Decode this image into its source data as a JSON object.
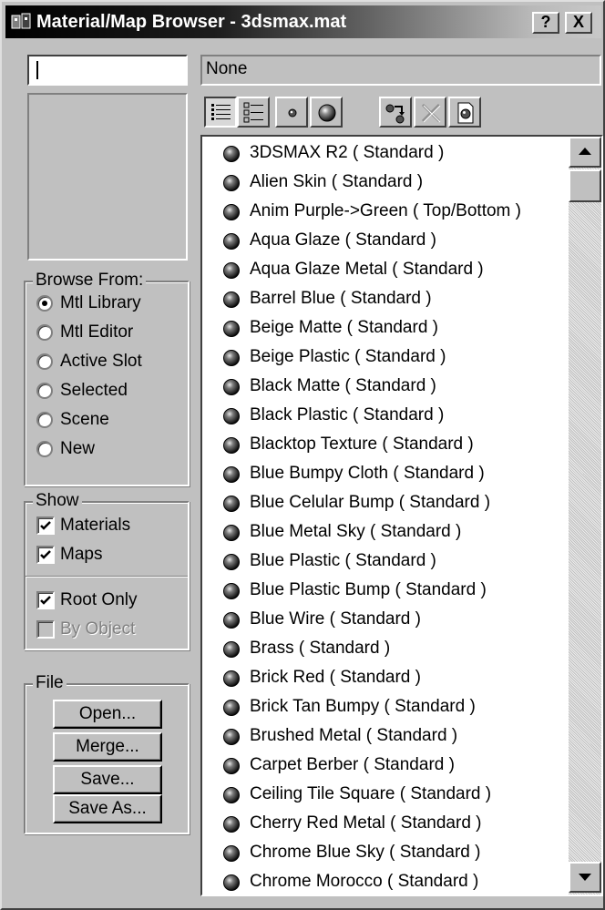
{
  "window": {
    "title": "Material/Map Browser - 3dsmax.mat",
    "help_label": "?",
    "close_label": "X"
  },
  "search": {
    "value": ""
  },
  "name_field": {
    "value": "None"
  },
  "toolbar": {
    "buttons": [
      "view-list",
      "view-list-icons",
      "view-small-icons",
      "view-large-icons",
      "update-scene-materials",
      "delete-from-library",
      "clear-material-library"
    ]
  },
  "browse_from": {
    "title": "Browse From:",
    "options": [
      "Mtl Library",
      "Mtl Editor",
      "Active Slot",
      "Selected",
      "Scene",
      "New"
    ],
    "selected": "Mtl Library"
  },
  "show": {
    "title": "Show",
    "materials_label": "Materials",
    "materials_checked": true,
    "maps_label": "Maps",
    "maps_checked": true,
    "root_only_label": "Root Only",
    "root_only_checked": true,
    "by_object_label": "By Object",
    "by_object_checked": false
  },
  "file": {
    "title": "File",
    "open_label": "Open...",
    "merge_label": "Merge...",
    "save_label": "Save...",
    "save_as_label": "Save As..."
  },
  "materials": [
    "3DSMAX R2  ( Standard )",
    "Alien Skin  ( Standard )",
    "Anim Purple->Green  ( Top/Bottom )",
    "Aqua Glaze  ( Standard )",
    "Aqua Glaze Metal  ( Standard )",
    "Barrel Blue  ( Standard )",
    "Beige Matte  ( Standard )",
    "Beige Plastic  ( Standard )",
    "Black Matte  ( Standard )",
    "Black Plastic  ( Standard )",
    "Blacktop Texture  ( Standard )",
    "Blue Bumpy Cloth  ( Standard )",
    "Blue Celular Bump  ( Standard )",
    "Blue Metal Sky  ( Standard )",
    "Blue Plastic  ( Standard )",
    "Blue Plastic Bump  ( Standard )",
    "Blue Wire  ( Standard )",
    "Brass  ( Standard )",
    "Brick Red  ( Standard )",
    "Brick Tan Bumpy  ( Standard )",
    "Brushed Metal  ( Standard )",
    "Carpet Berber  ( Standard )",
    "Ceiling Tile Square  ( Standard )",
    "Cherry Red Metal  ( Standard )",
    "Chrome Blue Sky  ( Standard )",
    "Chrome Morocco  ( Standard )"
  ],
  "colors": {
    "face": "#c0c0c0",
    "highlight": "#ffffff",
    "shadow": "#808080",
    "dark_shadow": "#404040",
    "title_start": "#000000",
    "title_end": "#c8c8c8"
  }
}
